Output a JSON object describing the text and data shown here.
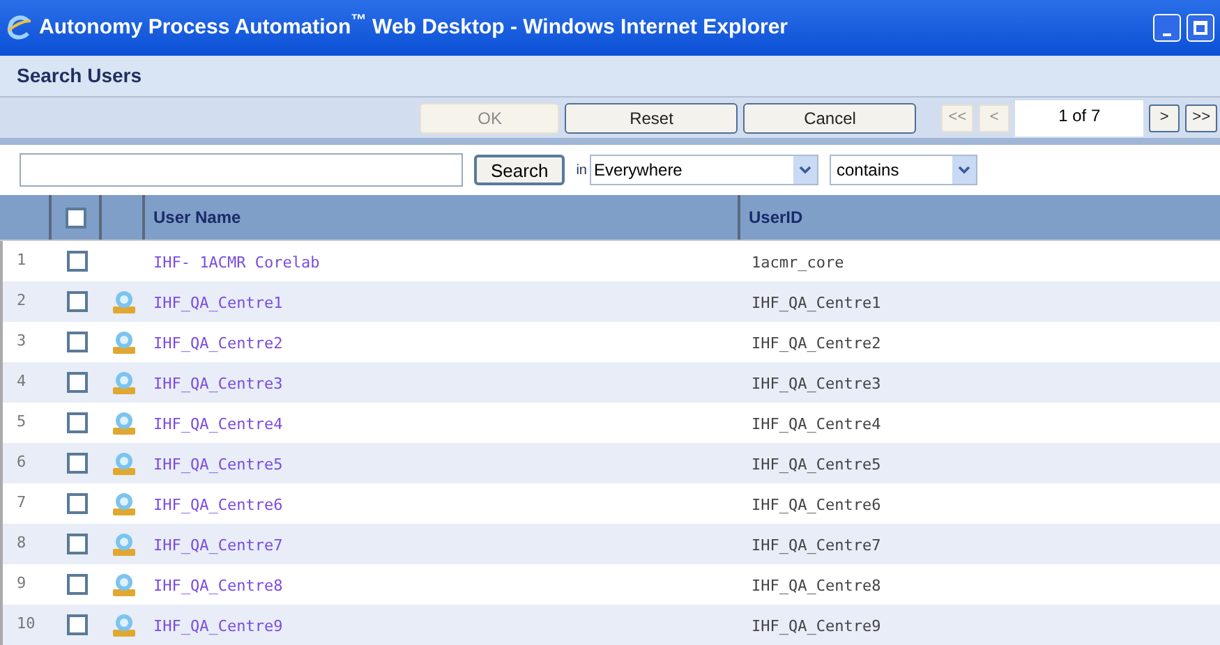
{
  "window": {
    "title": "Autonomy Process Automation$^{™}$ Web Desktop - Windows Internet Explorer"
  },
  "panel_title": "Search Users",
  "toolbar": {
    "buttons": [
      {
        "label": "OK",
        "disabled": true
      },
      {
        "label": "Reset",
        "disabled": false
      },
      {
        "label": "Cancel",
        "disabled": false
      }
    ],
    "pager": {
      "first": {
        "label": "<<",
        "disabled": true
      },
      "prev": {
        "label": "<",
        "disabled": true
      },
      "page": "1 of 7",
      "next": {
        "label": ">",
        "disabled": false
      },
      "last": {
        "label": ">>",
        "disabled": false
      }
    }
  },
  "search": {
    "button": "Search",
    "in_label": "in",
    "scope": "Everywhere",
    "match": "contains"
  },
  "table": {
    "columns": [
      "User Name",
      "UserID"
    ],
    "select_all": false,
    "rows": [
      {
        "number": "1",
        "checked": false,
        "kind": "plain",
        "name": "IHF- 1ACMR Corelab",
        "userid": "1acmr_core"
      },
      {
        "number": "2",
        "checked": false,
        "kind": "user",
        "name": "IHF_QA_Centre1",
        "userid": "IHF_QA_Centre1"
      },
      {
        "number": "3",
        "checked": false,
        "kind": "user",
        "name": "IHF_QA_Centre2",
        "userid": "IHF_QA_Centre2"
      },
      {
        "number": "4",
        "checked": false,
        "kind": "user",
        "name": "IHF_QA_Centre3",
        "userid": "IHF_QA_Centre3"
      },
      {
        "number": "5",
        "checked": false,
        "kind": "user",
        "name": "IHF_QA_Centre4",
        "userid": "IHF_QA_Centre4"
      },
      {
        "number": "6",
        "checked": false,
        "kind": "user",
        "name": "IHF_QA_Centre5",
        "userid": "IHF_QA_Centre5"
      },
      {
        "number": "7",
        "checked": false,
        "kind": "user",
        "name": "IHF_QA_Centre6",
        "userid": "IHF_QA_Centre6"
      },
      {
        "number": "8",
        "checked": false,
        "kind": "user",
        "name": "IHF_QA_Centre7",
        "userid": "IHF_QA_Centre7"
      },
      {
        "number": "9",
        "checked": false,
        "kind": "user",
        "name": "IHF_QA_Centre8",
        "userid": "IHF_QA_Centre8"
      },
      {
        "number": "10",
        "checked": false,
        "kind": "user",
        "name": "IHF_QA_Centre9",
        "userid": "IHF_QA_Centre9"
      }
    ]
  }
}
